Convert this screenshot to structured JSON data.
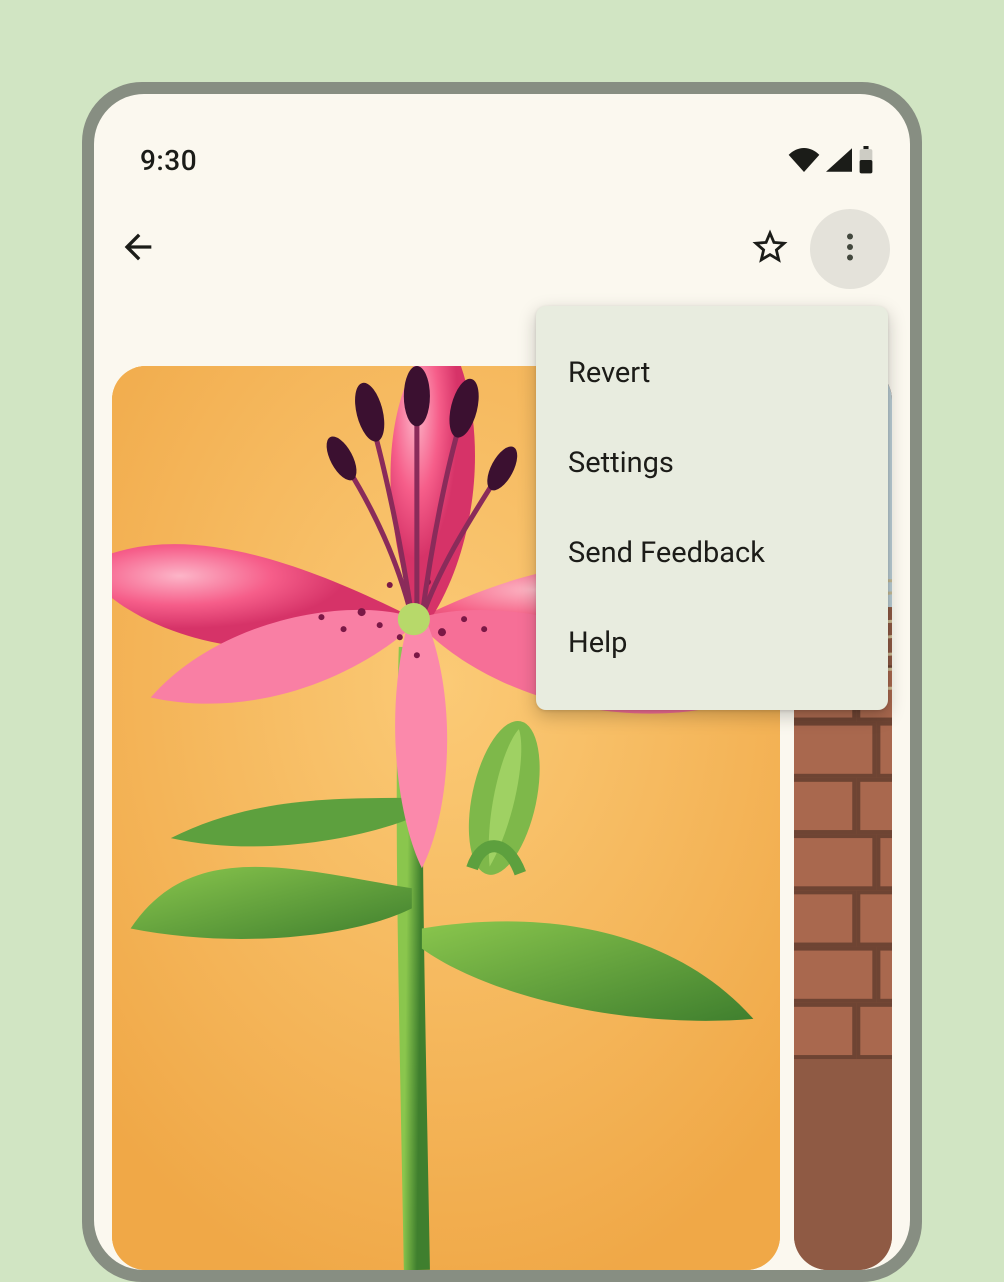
{
  "status": {
    "time": "9:30"
  },
  "menu": {
    "items": [
      {
        "label": "Revert"
      },
      {
        "label": "Settings"
      },
      {
        "label": "Send Feedback"
      },
      {
        "label": "Help"
      }
    ]
  }
}
